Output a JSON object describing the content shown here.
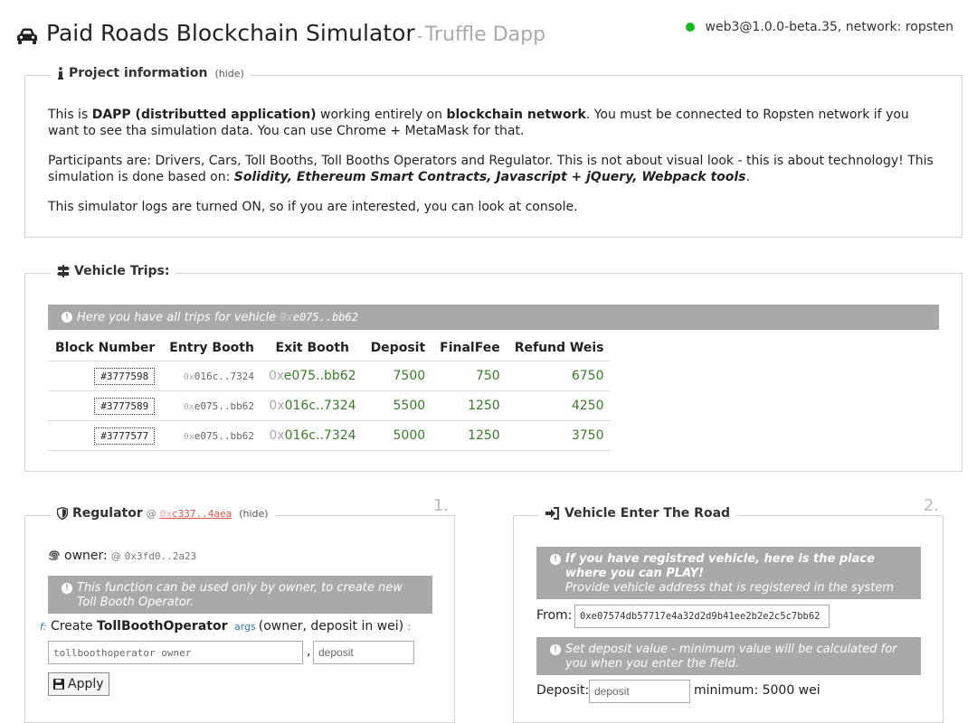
{
  "header": {
    "title": "Paid Roads Blockchain Simulator",
    "separator": "-",
    "subtitle": "Truffle Dapp",
    "status": "web3@1.0.0-beta.35, network: ropsten",
    "status_color": "#19b81d"
  },
  "project": {
    "legend": "Project information",
    "hide": "(hide)",
    "p1": {
      "a": "This is ",
      "b": "DAPP (distributted application)",
      "c": " working entirely on ",
      "d": "blockchain network",
      "e": ". You must be connected to Ropsten network if you want to see tha simulation data. You can use Chrome + MetaMask for that."
    },
    "p2": {
      "a": "Participants are: Drivers, Cars, Toll Booths, Toll Booths Operators and Regulator. This is not about visual look - this is about technology! This simulation is done based on: ",
      "b": "Solidity, Ethereum Smart Contracts, Javascript + jQuery, Webpack tools",
      "c": "."
    },
    "p3": "This simulator logs are turned ON, so if you are interested, you can look at console."
  },
  "trips": {
    "legend": "Vehicle Trips:",
    "banner_text": "Here you have all trips for vehicle",
    "vehicle_prefix": "0x",
    "vehicle": "e075..bb62",
    "columns": [
      "Block Number",
      "Entry Booth",
      "Exit Booth",
      "Deposit",
      "FinalFee",
      "Refund Weis"
    ],
    "rows": [
      {
        "block": "#3777598",
        "entry_prefix": "0x",
        "entry": "016c..7324",
        "exit_prefix": "0x",
        "exit": "e075..bb62",
        "deposit": "7500",
        "fee": "750",
        "refund": "6750"
      },
      {
        "block": "#3777589",
        "entry_prefix": "0x",
        "entry": "e075..bb62",
        "exit_prefix": "0x",
        "exit": "016c..7324",
        "deposit": "5500",
        "fee": "1250",
        "refund": "4250"
      },
      {
        "block": "#3777577",
        "entry_prefix": "0x",
        "entry": "e075..bb62",
        "exit_prefix": "0x",
        "exit": "016c..7324",
        "deposit": "5000",
        "fee": "1250",
        "refund": "3750"
      }
    ]
  },
  "regulator": {
    "legend": "Regulator",
    "at": "@",
    "addr_prefix": "0x",
    "addr": "c337..4aea",
    "hide": "(hide)",
    "step": "1.",
    "owner_label": "owner:",
    "owner_at": "@",
    "owner_addr": "0x3fd0..2a23",
    "banner": "This function can be used only by owner, to create new Toll Booth Operator.",
    "fn_prefix": "f:",
    "fn_create": "Create",
    "fn_name": "TollBoothOperator",
    "fn_args": "args",
    "fn_params": "(owner, deposit in wei)",
    "fn_colon": ":",
    "owner_placeholder": "tollboothoperator owner",
    "comma": ",",
    "deposit_placeholder": "deposit",
    "apply": "Apply"
  },
  "enter": {
    "legend": "Vehicle Enter The Road",
    "step": "2.",
    "banner1_strong": "If you have registred vehicle, here is the place where you can PLAY!",
    "banner1_text": "Provide vehicle address that is registered in the system",
    "from_label": "From:",
    "from_value": "0xe07574db57717e4a32d2d9b41ee2b2e2c5c7bb62",
    "banner2": "Set deposit value - minimum value will be calculated for you when you enter the field.",
    "deposit_label": "Deposit:",
    "deposit_placeholder": "deposit",
    "minimum": "minimum: 5000 wei"
  }
}
